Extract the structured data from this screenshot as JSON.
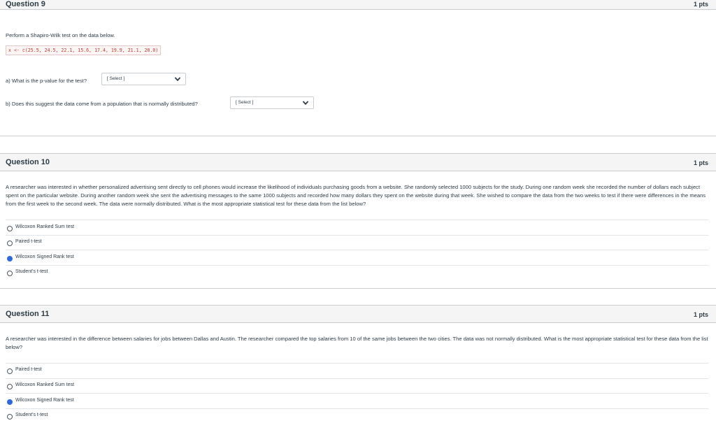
{
  "q9": {
    "title": "Question 9",
    "pts": "1 pts",
    "prompt": "Perform a Shapiro-Wilk test on the data below.",
    "code": "x <- c(25.5, 24.5, 22.1, 15.6, 17.4, 19.9, 21.1, 20.0)",
    "part_a": "a) What is the p-value for the test?",
    "part_a_select": "[ Select ]",
    "part_b": "b) Does this suggest the data come from a population that is normally distributed?",
    "part_b_select": "[ Select ]"
  },
  "q10": {
    "title": "Question 10",
    "pts": "1 pts",
    "body": "A researcher was interested in whether personalized advertising sent directly to cell phones would increase the likelihood of individuals purchasing goods from a website. She randomly selected 1000 subjects for the study. During one random week she recorded the number of dollars each subject spent on the particular website.  During another random week she sent the advertising messages to the same 1000 subjects and recorded how many dollars they spent on the website during that week. She wished to compare the data from the two weeks to test if there were differences in the means from the first week to the second week. The data were normally distributed.  What is the most appropriate statistical test for these data from the list below?",
    "options": [
      {
        "label": "Wilcoxon Ranked Sum test",
        "checked": false
      },
      {
        "label": "Paired t-test",
        "checked": false
      },
      {
        "label": "Wilcoxon Signed Rank test",
        "checked": true
      },
      {
        "label": "Student's t-test",
        "checked": false
      }
    ]
  },
  "q11": {
    "title": "Question 11",
    "pts": "1 pts",
    "body": "A researcher was interested in the difference between salaries for jobs between Dallas and Austin. The researcher compared the top salaries from 10 of the same jobs between the two cities. The data was not normally distributed. What is the most appropriate statistical test for these data from the list below?",
    "options": [
      {
        "label": "Paired t-test",
        "checked": false
      },
      {
        "label": "Wilcoxon Ranked Sum test",
        "checked": false
      },
      {
        "label": "Wilcoxon Signed Rank test",
        "checked": true
      },
      {
        "label": "Student's t-test",
        "checked": false
      }
    ]
  }
}
